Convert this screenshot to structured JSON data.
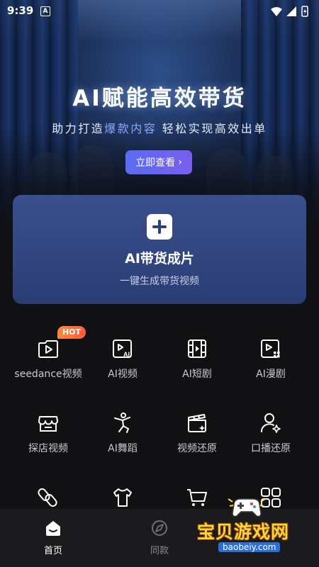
{
  "status_bar": {
    "time": "9:39",
    "badge": "A"
  },
  "hero": {
    "title": "AI赋能高效带货",
    "subtitle_prefix": "助力打造",
    "subtitle_highlight": "爆款内容",
    "subtitle_suffix": " 轻松实现高效出单",
    "button_label": "立即查看",
    "button_arrow": "›"
  },
  "main_card": {
    "title": "AI带货成片",
    "description": "一键生成带货视频"
  },
  "hot_badge": "HOT",
  "features": [
    {
      "label": "seedance视频",
      "icon": "play-icon"
    },
    {
      "label": "AI视频",
      "icon": "ai-video-icon"
    },
    {
      "label": "AI短剧",
      "icon": "film-icon"
    },
    {
      "label": "AI漫剧",
      "icon": "comic-icon"
    },
    {
      "label": "探店视频",
      "icon": "store-icon"
    },
    {
      "label": "AI舞蹈",
      "icon": "dance-icon"
    },
    {
      "label": "视频还原",
      "icon": "clapper-icon"
    },
    {
      "label": "口播还原",
      "icon": "person-icon"
    },
    {
      "label": "",
      "icon": "link-icon"
    },
    {
      "label": "",
      "icon": "shirt-icon"
    },
    {
      "label": "",
      "icon": "cart-icon"
    },
    {
      "label": "",
      "icon": "grid-icon"
    }
  ],
  "nav": [
    {
      "label": "首页",
      "icon": "home-icon",
      "active": true
    },
    {
      "label": "同款",
      "icon": "compass-icon",
      "active": false
    }
  ],
  "watermark": {
    "text": "宝贝游戏网",
    "url": "baobeiy.com"
  },
  "colors": {
    "background": "#111113",
    "card": "#34498a",
    "accent": "#6a66f0",
    "hot": "#ff6e3c"
  }
}
